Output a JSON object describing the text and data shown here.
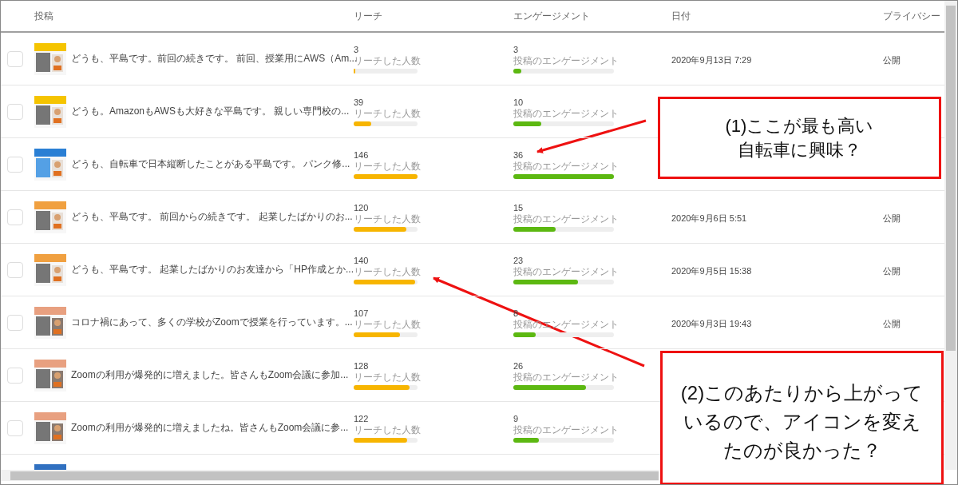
{
  "table": {
    "columns": [
      "投稿",
      "リーチ",
      "エンゲージメント",
      "日付",
      "プライバシー"
    ],
    "rows": [
      {
        "kind": "post",
        "selected": false,
        "text": "どうも、平島です。前回の続きです。 前回、授業用にAWS（Am...",
        "reach": {
          "value": "3",
          "label": "リーチした人数",
          "level": 0.03
        },
        "engagement": {
          "value": "3",
          "label": "投稿のエンゲージメント",
          "level": 0.08
        },
        "date": "2020年9月13日 7:29",
        "privacy": "公開"
      },
      {
        "kind": "post",
        "selected": false,
        "text": "どうも。AmazonもAWSも大好きな平島です。 親しい専門校の...",
        "reach": {
          "value": "39",
          "label": "リーチした人数",
          "level": 0.27
        },
        "engagement": {
          "value": "10",
          "label": "投稿のエンゲージメント",
          "level": 0.28
        }
      },
      {
        "kind": "post",
        "selected": false,
        "text": "どうも、自転車で日本縦断したことがある平島です。 パンク修...",
        "reach": {
          "value": "146",
          "label": "リーチした人数",
          "level": 1.0
        },
        "engagement": {
          "value": "36",
          "label": "投稿のエンゲージメント",
          "level": 1.0
        }
      },
      {
        "kind": "post",
        "selected": false,
        "text": "どうも、平島です。 前回からの続きです。 起業したばかりのお...",
        "reach": {
          "value": "120",
          "label": "リーチした人数",
          "level": 0.82
        },
        "engagement": {
          "value": "15",
          "label": "投稿のエンゲージメント",
          "level": 0.42
        },
        "date": "2020年9月6日 5:51",
        "privacy": "公開"
      },
      {
        "kind": "post",
        "selected": false,
        "text": "どうも、平島です。 起業したばかりのお友達から「HP作成とか...",
        "reach": {
          "value": "140",
          "label": "リーチした人数",
          "level": 0.96
        },
        "engagement": {
          "value": "23",
          "label": "投稿のエンゲージメント",
          "level": 0.64
        },
        "date": "2020年9月5日 15:38",
        "privacy": "公開"
      },
      {
        "kind": "post",
        "selected": false,
        "text": "コロナ禍にあって、多くの学校がZoomで授業を行っています。...",
        "reach": {
          "value": "107",
          "label": "リーチした人数",
          "level": 0.73
        },
        "engagement": {
          "value": "8",
          "label": "投稿のエンゲージメント",
          "level": 0.22
        },
        "date": "2020年9月3日 19:43",
        "privacy": "公開"
      },
      {
        "kind": "post",
        "selected": false,
        "text": "Zoomの利用が爆発的に増えました。皆さんもZoom会議に参加...",
        "reach": {
          "value": "128",
          "label": "リーチした人数",
          "level": 0.88
        },
        "engagement": {
          "value": "26",
          "label": "投稿のエンゲージメント",
          "level": 0.72
        }
      },
      {
        "kind": "post",
        "selected": false,
        "text": "Zoomの利用が爆発的に増えましたね。皆さんもZoom会議に参...",
        "reach": {
          "value": "122",
          "label": "リーチした人数",
          "level": 0.84
        },
        "engagement": {
          "value": "9",
          "label": "投稿のエンゲージメント",
          "level": 0.25
        }
      },
      {
        "kind": "partial"
      }
    ]
  },
  "callouts": [
    {
      "lines": [
        "(1)ここが最も高い",
        "自転車に興味？"
      ]
    },
    {
      "lines": [
        "(2)このあたりから上がって",
        "いるので、アイコンを変え",
        "たのが良かった？"
      ]
    }
  ]
}
